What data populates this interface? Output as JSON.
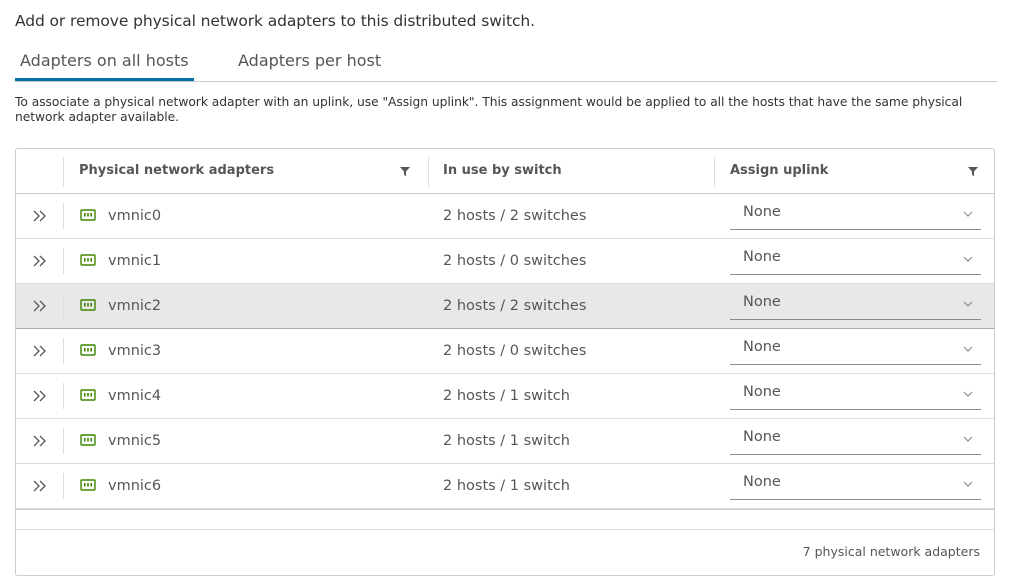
{
  "intro_text": "Add or remove physical network adapters to this distributed switch.",
  "tabs": [
    {
      "label": "Adapters on all hosts",
      "active": true
    },
    {
      "label": "Adapters per host",
      "active": false
    }
  ],
  "description": "To associate a physical network adapter with an uplink, use \"Assign uplink\". This assignment would be applied to all the hosts that have the same physical network adapter available.",
  "grid": {
    "columns": [
      "Physical network adapters",
      "In use by switch",
      "Assign uplink"
    ],
    "rows": [
      {
        "name": "vmnic0",
        "in_use": "2 hosts / 2 switches",
        "uplink": "None"
      },
      {
        "name": "vmnic1",
        "in_use": "2 hosts / 0 switches",
        "uplink": "None"
      },
      {
        "name": "vmnic2",
        "in_use": "2 hosts / 2 switches",
        "uplink": "None"
      },
      {
        "name": "vmnic3",
        "in_use": "2 hosts / 0 switches",
        "uplink": "None"
      },
      {
        "name": "vmnic4",
        "in_use": "2 hosts / 1 switch",
        "uplink": "None"
      },
      {
        "name": "vmnic5",
        "in_use": "2 hosts / 1 switch",
        "uplink": "None"
      },
      {
        "name": "vmnic6",
        "in_use": "2 hosts / 1 switch",
        "uplink": "None"
      }
    ],
    "selected_row_index": 2,
    "footer": "7 physical network adapters"
  },
  "icons": {
    "expand": "double-chevron-right-icon",
    "nic": "network-adapter-icon",
    "filter": "filter-icon",
    "dropdown": "chevron-down-icon"
  },
  "colors": {
    "tab_underline": "#0072a3",
    "nic_icon": "#3c8500",
    "selected_row": "#e8e8e8"
  }
}
